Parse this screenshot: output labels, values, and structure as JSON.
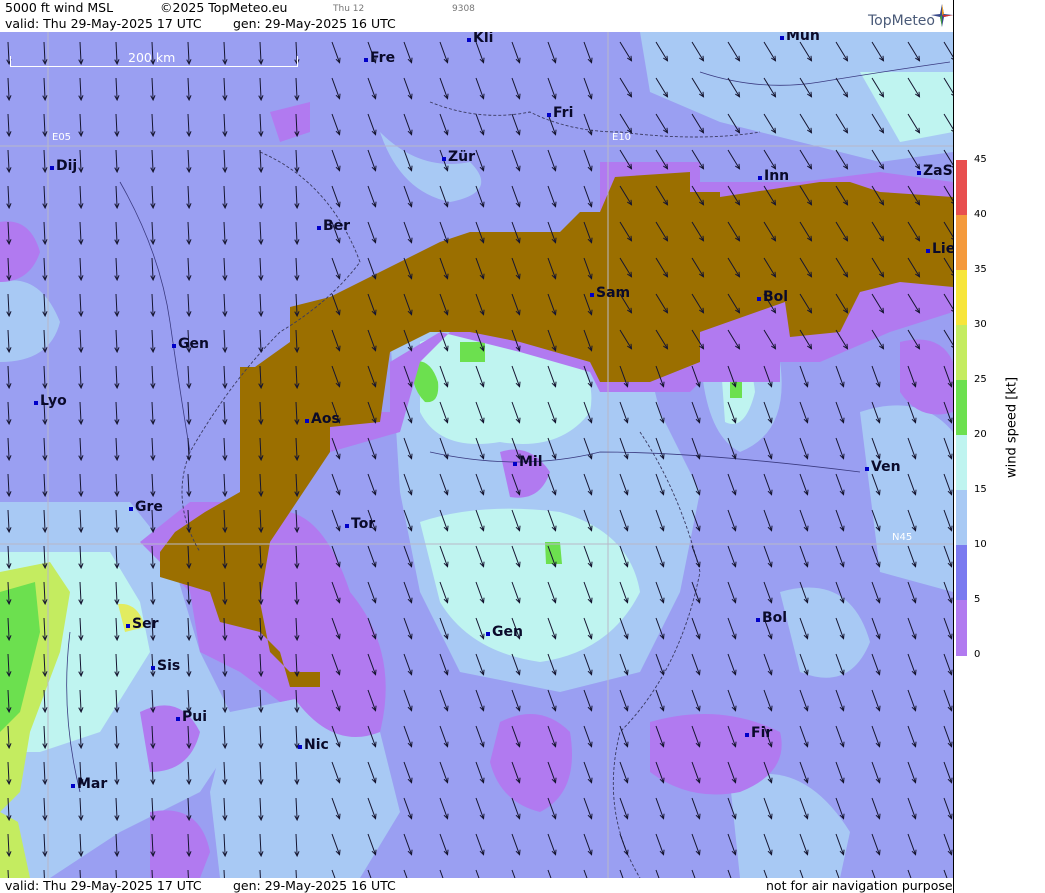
{
  "header": {
    "title": "5000 ft wind MSL",
    "copyright": "©2025 TopMeteo.eu",
    "small_day": "Thu 12",
    "small_code": "9308",
    "valid": "valid:  Thu   29-May-2025  17 UTC",
    "gen": "gen:  29-May-2025 16 UTC",
    "brand": "TopMeteo"
  },
  "footer": {
    "valid": "valid:  Thu   29-May-2025  17 UTC",
    "gen": "gen:  29-May-2025 16 UTC",
    "disclaimer": "not for air navigation purposes"
  },
  "scale_bar": {
    "label": "200 km"
  },
  "graticule": {
    "lon_left": "E05",
    "lon_right": "E10",
    "lat": "N45"
  },
  "colorbar": {
    "title": "wind speed [kt]",
    "ticks": [
      "45",
      "40",
      "35",
      "30",
      "25",
      "20",
      "15",
      "10",
      "5",
      "0"
    ],
    "colors": [
      "#e84f4f",
      "#f49a3c",
      "#f7e53a",
      "#c4ec60",
      "#6ce04f",
      "#bff4f0",
      "#a8c9f4",
      "#7a7af0",
      "#b17af0"
    ]
  },
  "cities": [
    {
      "name": "Kli"
    },
    {
      "name": "Mün"
    },
    {
      "name": "Fre"
    },
    {
      "name": "Fri"
    },
    {
      "name": "Dij"
    },
    {
      "name": "Zür"
    },
    {
      "name": "Inn"
    },
    {
      "name": "ZaS"
    },
    {
      "name": "Ber"
    },
    {
      "name": "Lie"
    },
    {
      "name": "Sam"
    },
    {
      "name": "Bol"
    },
    {
      "name": "Gen"
    },
    {
      "name": "Lyo"
    },
    {
      "name": "Aos"
    },
    {
      "name": "Mil"
    },
    {
      "name": "Ven"
    },
    {
      "name": "Gre"
    },
    {
      "name": "Tor"
    },
    {
      "name": "Ser"
    },
    {
      "name": "Gen"
    },
    {
      "name": "Bol"
    },
    {
      "name": "Sis"
    },
    {
      "name": "Pui"
    },
    {
      "name": "Nic"
    },
    {
      "name": "Fir"
    },
    {
      "name": "Mar"
    }
  ]
}
